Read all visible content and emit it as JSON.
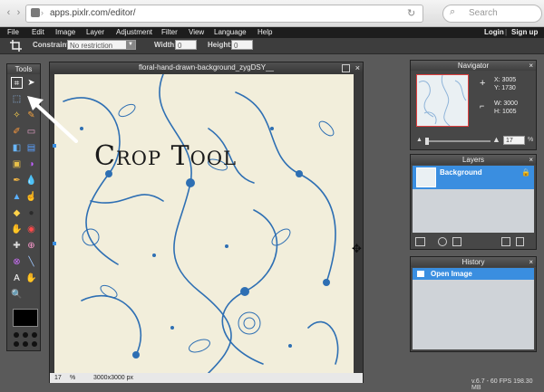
{
  "browser": {
    "url": "apps.pixlr.com/editor/",
    "search_placeholder": "Search"
  },
  "menu": {
    "items": [
      "File",
      "Edit",
      "Image",
      "Layer",
      "Adjustment",
      "Filter",
      "View",
      "Language",
      "Help"
    ],
    "login": "Login",
    "signup": "Sign up"
  },
  "options": {
    "constraint_label": "Constraint:",
    "constraint_value": "No restriction",
    "width_label": "Width:",
    "width_value": "0",
    "height_label": "Height:",
    "height_value": "0"
  },
  "tools": {
    "title": "Tools",
    "icons": [
      "crop-icon",
      "move-icon",
      "marquee-icon",
      "lasso-icon",
      "wand-icon",
      "pencil-icon",
      "brush-icon",
      "eraser-icon",
      "bucket-icon",
      "gradient-icon",
      "stamp-icon",
      "color-replace-icon",
      "drawing-icon",
      "blur-icon",
      "sharpen-icon",
      "smudge-icon",
      "sponge-icon",
      "dodge-icon",
      "burn-icon",
      "red-eye-icon",
      "spot-heal-icon",
      "bloat-icon",
      "pinch-icon",
      "eyedropper-icon",
      "text-icon",
      "hand-icon",
      "zoom-icon"
    ]
  },
  "canvas": {
    "title": "floral-hand-drawn-background_zygDSY__",
    "zoom": "17",
    "zoom_unit": "%",
    "size": "3000x3000 px"
  },
  "navigator": {
    "title": "Navigator",
    "x_label": "X:",
    "x_value": "3005",
    "y_label": "Y:",
    "y_value": "1730",
    "w_label": "W:",
    "w_value": "3000",
    "h_label": "H:",
    "h_value": "1005",
    "zoom": "17",
    "zoom_unit": "%"
  },
  "layers": {
    "title": "Layers",
    "items": [
      {
        "name": "Background"
      }
    ]
  },
  "history": {
    "title": "History",
    "items": [
      {
        "name": "Open Image"
      }
    ]
  },
  "status": {
    "version": "v.6.7 - 60 FPS 198.30 MB"
  },
  "annotation": {
    "caption": "Crop Tool"
  },
  "colors": {
    "accent": "#3a8ee0",
    "pattern_blue": "#2e6fb3",
    "canvas_bg": "#f2eedb"
  }
}
